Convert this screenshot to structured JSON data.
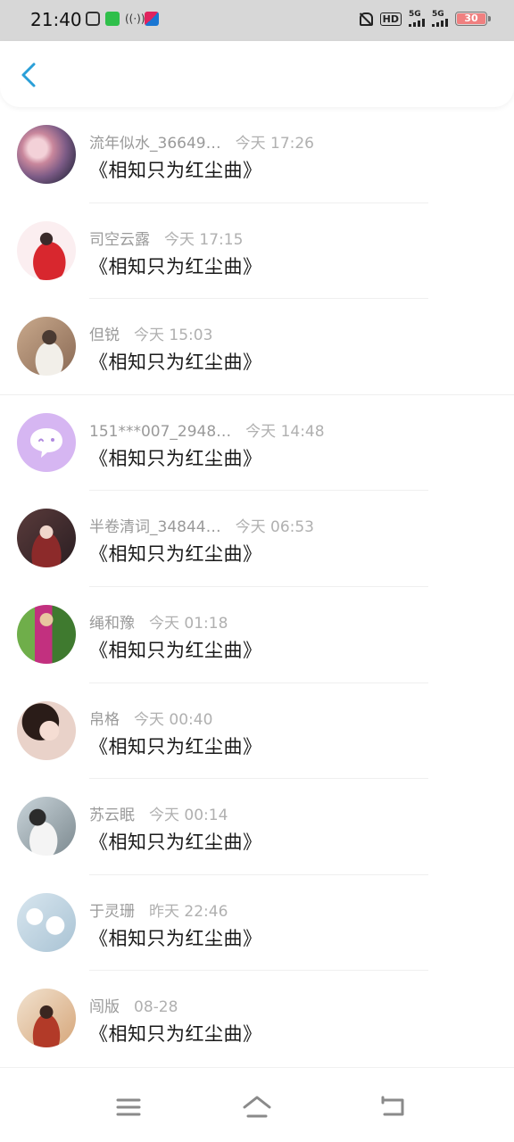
{
  "status_bar": {
    "time": "21:40",
    "hd_label": "HD",
    "sim1_label": "5G",
    "sim2_label": "5G",
    "battery_level": "30"
  },
  "header": {
    "back_icon": "chevron-left-icon"
  },
  "colors": {
    "accent": "#2a9fd8",
    "name_gray": "#9a9a9a",
    "time_gray": "#b0b0b0"
  },
  "messages": [
    {
      "name": "流年似水_36649…",
      "time": "今天 17:26",
      "text": "《相知只为红尘曲》"
    },
    {
      "name": "司空云露",
      "time": "今天 17:15",
      "text": "《相知只为红尘曲》"
    },
    {
      "name": "但锐",
      "time": "今天 15:03",
      "text": "《相知只为红尘曲》"
    },
    {
      "name": "151***007_2948…",
      "time": "今天 14:48",
      "text": "《相知只为红尘曲》"
    },
    {
      "name": "半卷清词_34844…",
      "time": "今天 06:53",
      "text": "《相知只为红尘曲》"
    },
    {
      "name": "绳和豫",
      "time": "今天 01:18",
      "text": "《相知只为红尘曲》"
    },
    {
      "name": "帛格",
      "time": "今天 00:40",
      "text": "《相知只为红尘曲》"
    },
    {
      "name": "苏云眠",
      "time": "今天 00:14",
      "text": "《相知只为红尘曲》"
    },
    {
      "name": "于灵珊",
      "time": "昨天 22:46",
      "text": "《相知只为红尘曲》"
    },
    {
      "name": "闯版",
      "time": "08-28",
      "text": "《相知只为红尘曲》"
    }
  ],
  "nav_bar": {
    "menu_icon": "menu-icon",
    "home_icon": "home-icon",
    "back_icon": "back-icon"
  }
}
